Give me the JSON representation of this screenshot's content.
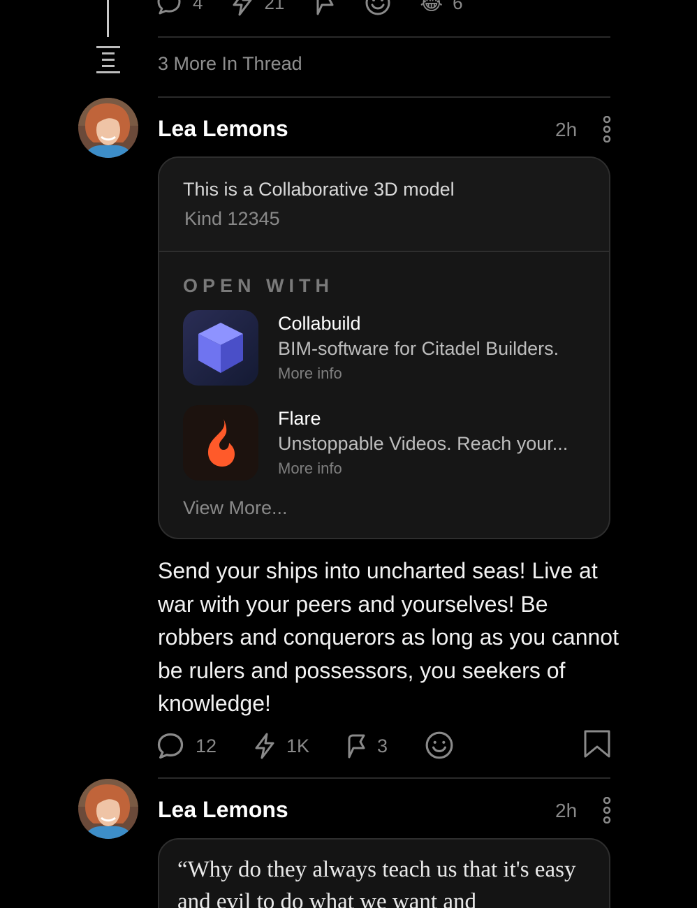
{
  "top_actions": {
    "replies": "4",
    "zaps": "21",
    "reactions_count": "6",
    "reaction_emoji": "😂"
  },
  "thread": {
    "more_label": "3 More In Thread"
  },
  "post1": {
    "author": "Lea Lemons",
    "time": "2h",
    "card": {
      "title": "This is a Collaborative 3D model",
      "kind": "Kind 12345",
      "open_with_label": "OPEN WITH",
      "apps": [
        {
          "name": "Collabuild",
          "description": "BIM-software for Citadel Builders.",
          "more": "More info",
          "icon": "cube-icon",
          "color": "#6a6ee8"
        },
        {
          "name": "Flare",
          "description": "Unstoppable Videos. Reach your...",
          "more": "More info",
          "icon": "flame-icon",
          "color": "#ff5a2a"
        }
      ],
      "view_more": "View More..."
    },
    "body": "Send your ships into uncharted seas! Live at war with your peers and yourselves! Be robbers and conquerors as long as you cannot be rulers and possessors, you seekers of knowledge!",
    "actions": {
      "replies": "12",
      "zaps": "1K",
      "reposts": "3"
    }
  },
  "post2": {
    "author": "Lea Lemons",
    "time": "2h",
    "quote": "“Why do they always teach us that it's easy and evil to do what we want and"
  },
  "colors": {
    "background": "#000000",
    "muted": "#8a8a8a",
    "card": "#161616",
    "divider": "#2a2a2a"
  }
}
